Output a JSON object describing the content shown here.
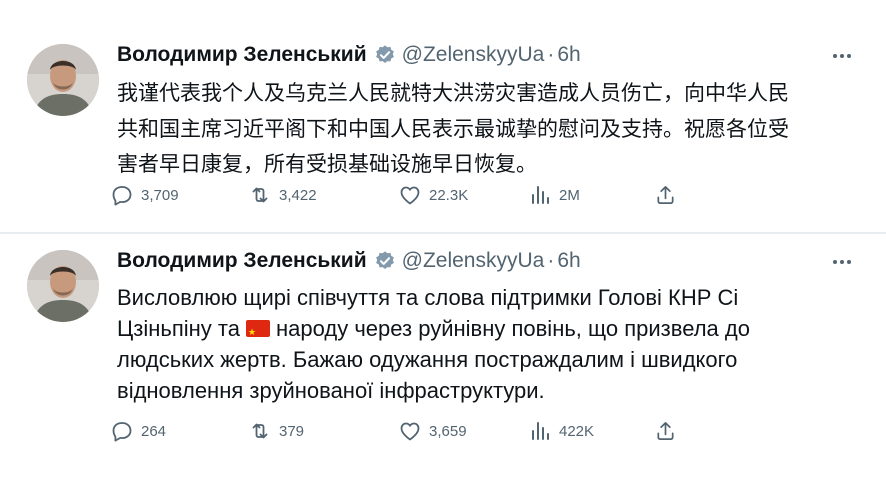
{
  "tweets": [
    {
      "author": {
        "name": "Володимир Зеленський",
        "handle": "@ZelenskyyUa",
        "separator": "·",
        "time": "6h"
      },
      "text": "我谨代表我个人及乌克兰人民就特大洪涝灾害造成人员伤亡，向中华人民\n共和国主席习近平阁下和中国人民表示最诚挚的慰问及支持。祝愿各位受\n害者早日康复，所有受损基础设施早日恢复。",
      "stats": {
        "replies": "3,709",
        "retweets": "3,422",
        "likes": "22.3K",
        "views": "2M"
      }
    },
    {
      "author": {
        "name": "Володимир Зеленський",
        "handle": "@ZelenskyyUa",
        "separator": "·",
        "time": "6h"
      },
      "text_before_flag": "Висловлюю щирі співчуття та слова підтримки Голові КНР Сі\nЦзіньпіну та",
      "flag_icon": "china-flag-icon",
      "text_after_flag": "народу через руйнівну повінь, що призвела до\nлюдських жертв. Бажаю одужання постраждалим і швидкого\nвідновлення зруйнованої інфраструктури.",
      "stats": {
        "replies": "264",
        "retweets": "379",
        "likes": "3,659",
        "views": "422K"
      }
    }
  ],
  "icons": {
    "reply": "speech-bubble-icon",
    "retweet": "retweet-arrows-icon",
    "like": "heart-icon",
    "views": "bar-chart-icon",
    "share": "share-upload-icon",
    "more": "more-dots-icon",
    "verified": "verified-badge-icon"
  },
  "colors": {
    "text": "#0f1419",
    "secondary": "#536471",
    "verified": "#829aab",
    "divider": "#e6ecf0"
  }
}
